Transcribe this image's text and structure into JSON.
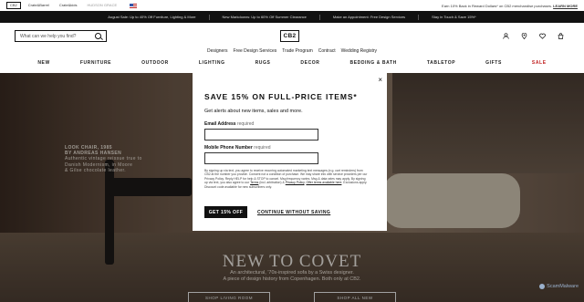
{
  "util_bar": {
    "brands": [
      "CB2",
      "Crate&Barrel",
      "Crate&kids",
      "HUDSON GRACE"
    ],
    "right_text": "Earn 10% Back in Reward Dollars* on CB2 merchandise purchases.",
    "right_link": "LEARN MORE"
  },
  "promo_bar": {
    "items": [
      "August Sale: Up to 40% Off Furniture, Lighting & More",
      "New Markdowns: Up to 60% Off Summer Clearance",
      "Make an Appointment: Free Design Services",
      "Stay in Touch & Save 15%*"
    ]
  },
  "header": {
    "search_placeholder": "What can we help you find?",
    "logo": "CB2",
    "icons": [
      "account-icon",
      "location-icon",
      "favorites-icon",
      "cart-icon"
    ],
    "subnav": [
      "Designers",
      "Free Design Services",
      "Trade Program",
      "Contract",
      "Wedding Registry"
    ],
    "mainnav": [
      "NEW",
      "FURNITURE",
      "OUTDOOR",
      "LIGHTING",
      "RUGS",
      "DECOR",
      "BEDDING & BATH",
      "TABLETOP",
      "GIFTS",
      "SALE"
    ]
  },
  "hero": {
    "caption_title": "LOOK CHAIR, 1985\nBY ANDREAS HANSEN",
    "caption_text": "Authentic vintage reissue true to\nDanish Modernism, in Moore\n& Gilse chocolate leather.",
    "title": "NEW TO COVET",
    "text_line1": "An architectural, '70s-inspired sofa by a Swiss designer.",
    "text_line2": "A piece of design history from Copenhagen. Both only at CB2.",
    "button1": "SHOP LIVING ROOM",
    "button2": "SHOP ALL NEW"
  },
  "modal": {
    "close": "×",
    "title": "SAVE 15% ON FULL-PRICE ITEMS*",
    "subtitle": "Get alerts about new items, sales and more.",
    "email_label": "Email Address",
    "email_req": "required",
    "phone_label": "Mobile Phone Number",
    "phone_req": "required",
    "legal_1": "By signing up via text, you agree to receive recurring automated marketing text messages (e.g. cart reminders) from CB2 at the number you provide. Consent not a condition of purchase. We may share info with service providers per our Privacy Policy. Reply HELP for help & STOP to cancel. Msg frequency varies. Msg & data rates may apply. By signing up via text, you also agree to our ",
    "legal_terms": "Terms",
    "legal_2": " (incl. arbitration) & ",
    "legal_privacy": "Privacy Policy",
    "legal_3": ". ",
    "legal_offer": "Offer terms available here",
    "legal_4": ". Exclusions apply. Discount code available for new subscribers only.",
    "cta": "GET 15% OFF",
    "continue": "CONTINUE WITHOUT SAVING"
  },
  "watermark": "ScamMalware"
}
